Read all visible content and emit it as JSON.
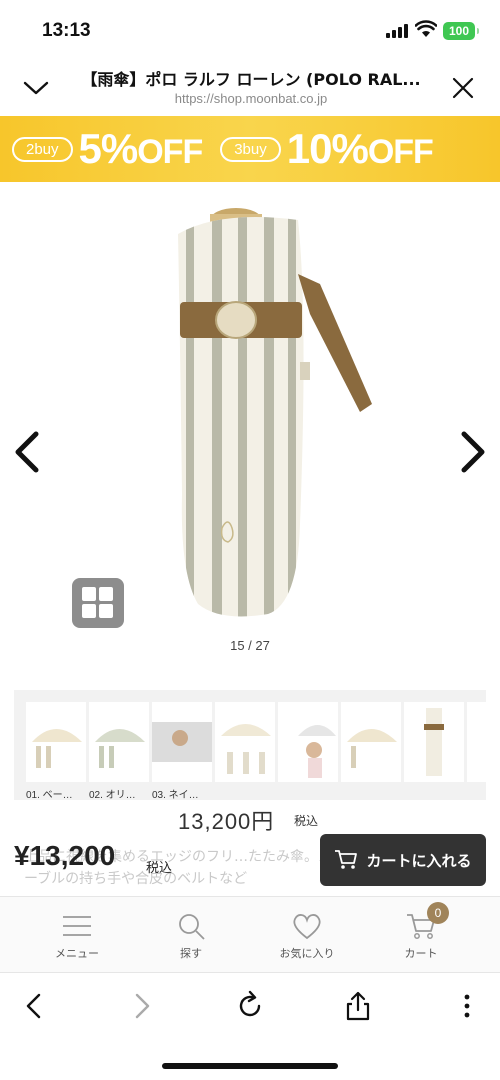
{
  "status_bar": {
    "time": "13:13",
    "battery": "100"
  },
  "browser": {
    "title": "【雨傘】ポロ ラルフ ローレン (POLO RAL...",
    "url": "https://shop.moonbat.co.jp"
  },
  "banner": {
    "offer1_label": "2buy",
    "offer1_value": "5%",
    "offer1_off": "OFF",
    "offer2_label": "3buy",
    "offer2_value": "10%",
    "offer2_off": "OFF"
  },
  "gallery": {
    "counter": "15 / 27"
  },
  "thumbnails": [
    {
      "label": "01. ベー…"
    },
    {
      "label": "02. オリ…"
    },
    {
      "label": "03. ネイ…"
    },
    {
      "label": ""
    },
    {
      "label": ""
    },
    {
      "label": ""
    },
    {
      "label": ""
    },
    {
      "label": ""
    }
  ],
  "product": {
    "price": "13,200円",
    "tax_label": "税込",
    "description": "上品に視線を集めるエッジのフリ…たたみ傘。ストライプの清らかさとマーブルの持ち手や合皮のベルトなど"
  },
  "sticky": {
    "price": "¥13,200",
    "tax_label": "税込",
    "cart_button": "カートに入れる"
  },
  "bottom_nav": {
    "menu": "メニュー",
    "search": "探す",
    "favorites": "お気に入り",
    "cart": "カート",
    "cart_count": "0",
    "badge_color": "#a0845a"
  },
  "colors": {
    "banner": "#f7c62b",
    "cart_button": "#333333"
  }
}
